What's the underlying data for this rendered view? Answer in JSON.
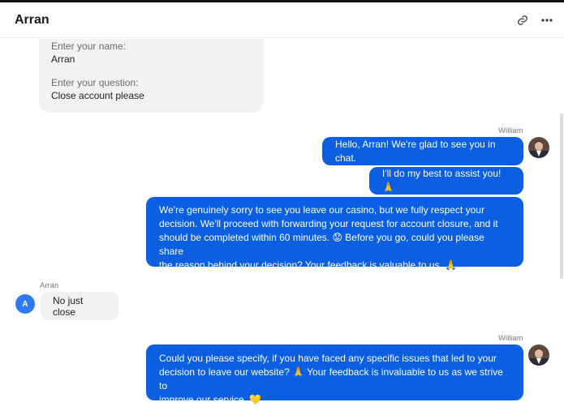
{
  "header": {
    "title": "Arran",
    "link_icon": "link-icon",
    "more_icon": "more-horizontal-icon"
  },
  "form": {
    "name_label": "Enter your name:",
    "name_value": "Arran",
    "question_label": "Enter your question:",
    "question_value": "Close account please"
  },
  "messages": {
    "agent_block_1": {
      "sender": "William",
      "m1": "Hello, Arran! We're glad to see you in chat.",
      "m2": "I'll do my best to assist you! 🙏",
      "m3_line1": "We're genuinely sorry to see you leave our casino, but we fully respect your",
      "m3_line2": "decision. We'll proceed with forwarding your request for account closure, and it",
      "m3_line3": "should be completed within 60 minutes. 😟 Before you go, could you please share",
      "m3_line4": "the reason behind your decision? Your feedback is valuable to us. 🙏"
    },
    "user_block": {
      "sender": "Arran",
      "avatar_letter": "A",
      "m1": "No just close"
    },
    "agent_block_2": {
      "sender": "William",
      "m1_line1": "Could you please specify, if you have faced any specific issues that led to your",
      "m1_line2": "decision to leave our website? 🙏 Your feedback is invaluable to us as we strive to",
      "m1_line3": "improve our service. 💛"
    }
  },
  "colors": {
    "agent_bubble": "#0b5fe0",
    "user_bubble": "#f1f1f2",
    "user_avatar": "#2f7bf0"
  }
}
